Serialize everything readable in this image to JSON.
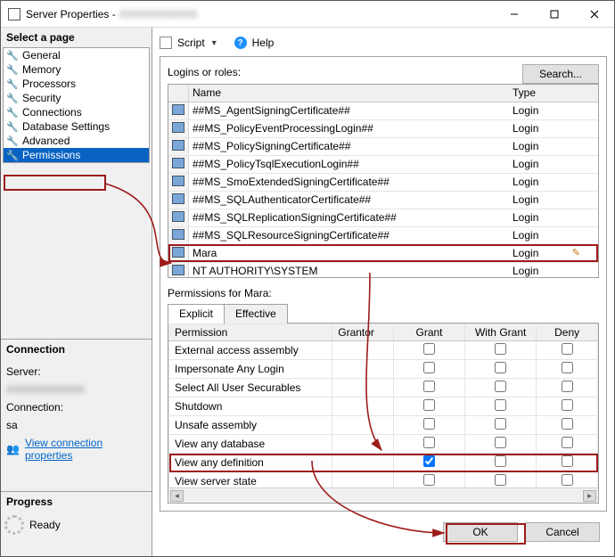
{
  "title_prefix": "Server Properties - ",
  "title_server_obscured": "XXXXXXXXXXX",
  "left": {
    "select_page": "Select a page",
    "pages": [
      "General",
      "Memory",
      "Processors",
      "Security",
      "Connections",
      "Database Settings",
      "Advanced",
      "Permissions"
    ],
    "selected_page_index": 7,
    "connection_hdr": "Connection",
    "server_label": "Server:",
    "server_value_obscured": "XXXXXXXXXXX",
    "connection_label": "Connection:",
    "connection_value": "sa",
    "view_conn_props": "View connection properties",
    "progress_hdr": "Progress",
    "progress_status": "Ready"
  },
  "toolbar": {
    "script": "Script",
    "help": "Help"
  },
  "logins": {
    "label": "Logins or roles:",
    "search_btn": "Search...",
    "cols": {
      "name": "Name",
      "type": "Type"
    },
    "rows": [
      {
        "name": "##MS_AgentSigningCertificate##",
        "type": "Login"
      },
      {
        "name": "##MS_PolicyEventProcessingLogin##",
        "type": "Login"
      },
      {
        "name": "##MS_PolicySigningCertificate##",
        "type": "Login"
      },
      {
        "name": "##MS_PolicyTsqlExecutionLogin##",
        "type": "Login"
      },
      {
        "name": "##MS_SmoExtendedSigningCertificate##",
        "type": "Login"
      },
      {
        "name": "##MS_SQLAuthenticatorCertificate##",
        "type": "Login"
      },
      {
        "name": "##MS_SQLReplicationSigningCertificate##",
        "type": "Login"
      },
      {
        "name": "##MS_SQLResourceSigningCertificate##",
        "type": "Login"
      },
      {
        "name": "Mara",
        "type": "Login",
        "highlighted": true,
        "editing": true
      },
      {
        "name": "NT AUTHORITY\\SYSTEM",
        "type": "Login"
      }
    ]
  },
  "perms": {
    "label_prefix": "Permissions for ",
    "target": "Mara",
    "label_suffix": ":",
    "tabs": [
      "Explicit",
      "Effective"
    ],
    "active_tab": 0,
    "cols": {
      "permission": "Permission",
      "grantor": "Grantor",
      "grant": "Grant",
      "with_grant": "With Grant",
      "deny": "Deny"
    },
    "rows": [
      {
        "permission": "External access assembly",
        "grant": false,
        "with_grant": false,
        "deny": false
      },
      {
        "permission": "Impersonate Any Login",
        "grant": false,
        "with_grant": false,
        "deny": false
      },
      {
        "permission": "Select All User Securables",
        "grant": false,
        "with_grant": false,
        "deny": false
      },
      {
        "permission": "Shutdown",
        "grant": false,
        "with_grant": false,
        "deny": false
      },
      {
        "permission": "Unsafe assembly",
        "grant": false,
        "with_grant": false,
        "deny": false
      },
      {
        "permission": "View any database",
        "grant": false,
        "with_grant": false,
        "deny": false
      },
      {
        "permission": "View any definition",
        "grant": true,
        "with_grant": false,
        "deny": false,
        "highlighted": true
      },
      {
        "permission": "View server state",
        "grant": false,
        "with_grant": false,
        "deny": false
      }
    ]
  },
  "footer": {
    "ok": "OK",
    "cancel": "Cancel"
  }
}
